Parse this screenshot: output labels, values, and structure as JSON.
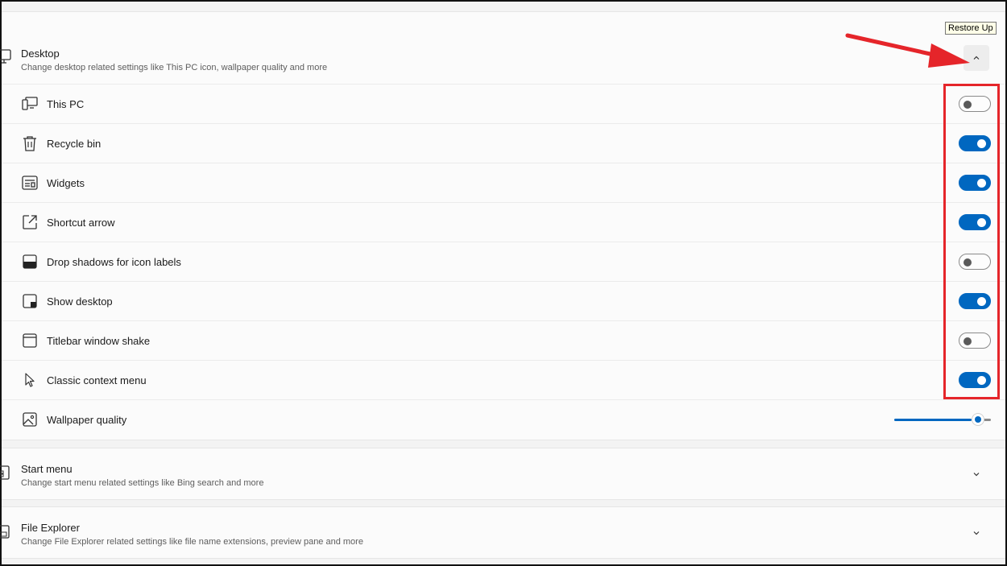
{
  "tooltip": "Restore Up",
  "sections": {
    "desktop": {
      "title": "Desktop",
      "description": "Change desktop related settings like This PC icon, wallpaper quality and more",
      "expanded": true
    },
    "start_menu": {
      "title": "Start menu",
      "description": "Change start menu related settings like Bing search and more",
      "expanded": false
    },
    "file_explorer": {
      "title": "File Explorer",
      "description": "Change File Explorer related settings like file name extensions, preview pane and more",
      "expanded": false
    }
  },
  "desktop_items": [
    {
      "label": "This PC",
      "icon": "this-pc-icon",
      "state": "off"
    },
    {
      "label": "Recycle bin",
      "icon": "recycle-bin-icon",
      "state": "on"
    },
    {
      "label": "Widgets",
      "icon": "widgets-icon",
      "state": "on"
    },
    {
      "label": "Shortcut arrow",
      "icon": "shortcut-arrow-icon",
      "state": "on"
    },
    {
      "label": "Drop shadows for icon labels",
      "icon": "drop-shadow-icon",
      "state": "off"
    },
    {
      "label": "Show desktop",
      "icon": "show-desktop-icon",
      "state": "on"
    },
    {
      "label": "Titlebar window shake",
      "icon": "titlebar-window-icon",
      "state": "off"
    },
    {
      "label": "Classic context menu",
      "icon": "cursor-icon",
      "state": "on"
    }
  ],
  "wallpaper": {
    "label": "Wallpaper quality",
    "icon": "image-icon",
    "slider_value_fraction": 0.8
  },
  "colors": {
    "accent": "#0067c0",
    "annotation": "#e5252a"
  }
}
